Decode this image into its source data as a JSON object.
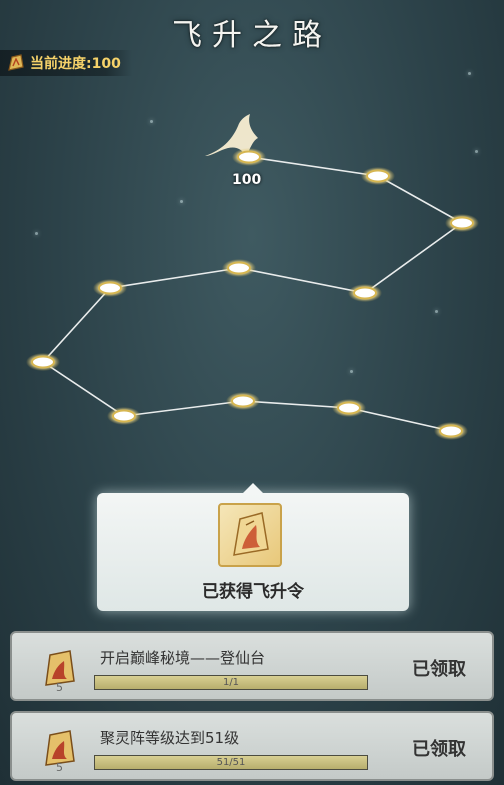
{
  "header": {
    "title": "飞升之路"
  },
  "progress": {
    "label": "当前进度:100"
  },
  "path": {
    "current_node_label": "100"
  },
  "tooltip": {
    "text": "已获得飞升令"
  },
  "tasks": [
    {
      "name": "开启巅峰秘境——登仙台",
      "count": "5",
      "progress_text": "1/1",
      "progress": 1.0,
      "status": "已领取"
    },
    {
      "name": "聚灵阵等级达到51级",
      "count": "5",
      "progress_text": "51/51",
      "progress": 1.0,
      "status": "已领取"
    }
  ]
}
